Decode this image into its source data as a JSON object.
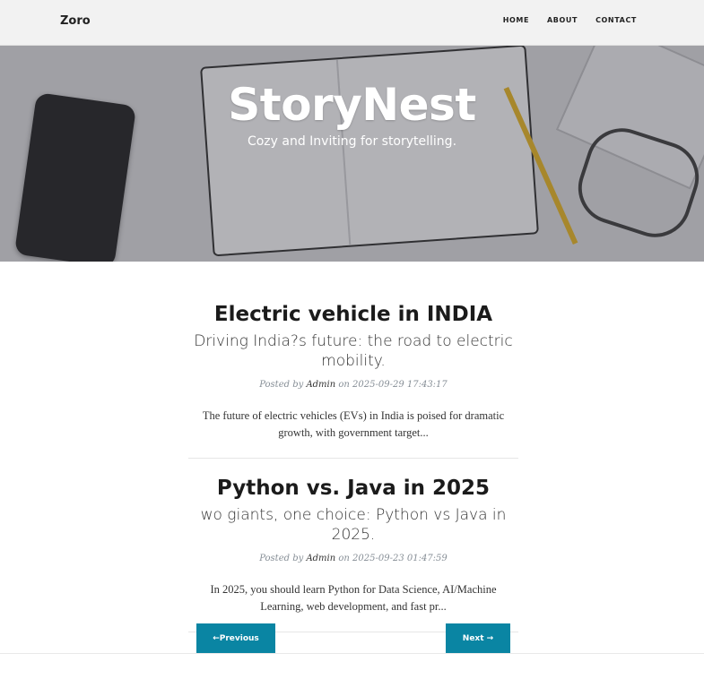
{
  "nav": {
    "brand": "Zoro",
    "links": [
      "HOME",
      "ABOUT",
      "CONTACT"
    ]
  },
  "hero": {
    "title": "StoryNest",
    "subtitle": "Cozy and Inviting for storytelling."
  },
  "posts": [
    {
      "title": "Electric vehicle in INDIA",
      "subtitle": "Driving India?s future: the road to electric mobility.",
      "meta_prefix": "Posted by",
      "author": "Admin",
      "meta_on": "on",
      "date": "2025-09-29 17:43:17",
      "excerpt": "The future of electric vehicles (EVs) in India is poised for dramatic growth, with government target..."
    },
    {
      "title": "Python vs. Java in 2025",
      "subtitle": "wo giants, one choice: Python vs Java in 2025.",
      "meta_prefix": "Posted by",
      "author": "Admin",
      "meta_on": "on",
      "date": "2025-09-23 01:47:59",
      "excerpt": "In 2025, you should learn Python for Data Science, AI/Machine Learning, web development, and fast pr..."
    }
  ],
  "pager": {
    "prev": "←Previous",
    "next": "Next →"
  },
  "colors": {
    "accent": "#0a85a3",
    "nav_bg": "#f2f2f2"
  }
}
